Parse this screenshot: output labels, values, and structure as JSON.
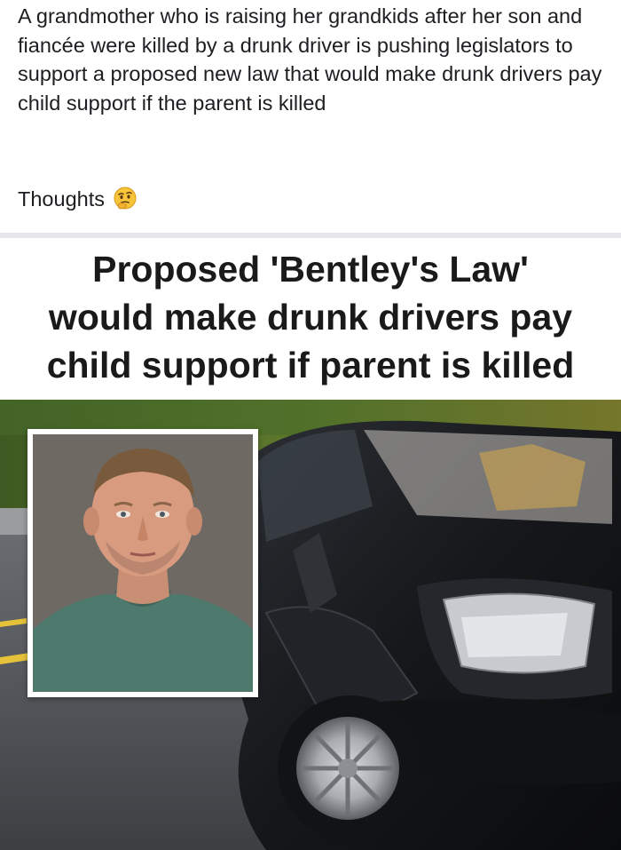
{
  "post": {
    "body": "A grandmother who is raising her grandkids after her son and fiancée were killed by a drunk driver is pushing legislators to support a proposed new law that would make drunk drivers pay child support if the parent is killed",
    "thoughts_label": "Thoughts",
    "emoji_icon": "thinking-face-emoji"
  },
  "headline": {
    "lines": [
      "Proposed 'Bentley's Law'",
      "would make drunk drivers pay",
      "child support if parent is killed"
    ]
  },
  "image": {
    "subjects": [
      "mugshot-photo",
      "crashed-black-car"
    ]
  }
}
